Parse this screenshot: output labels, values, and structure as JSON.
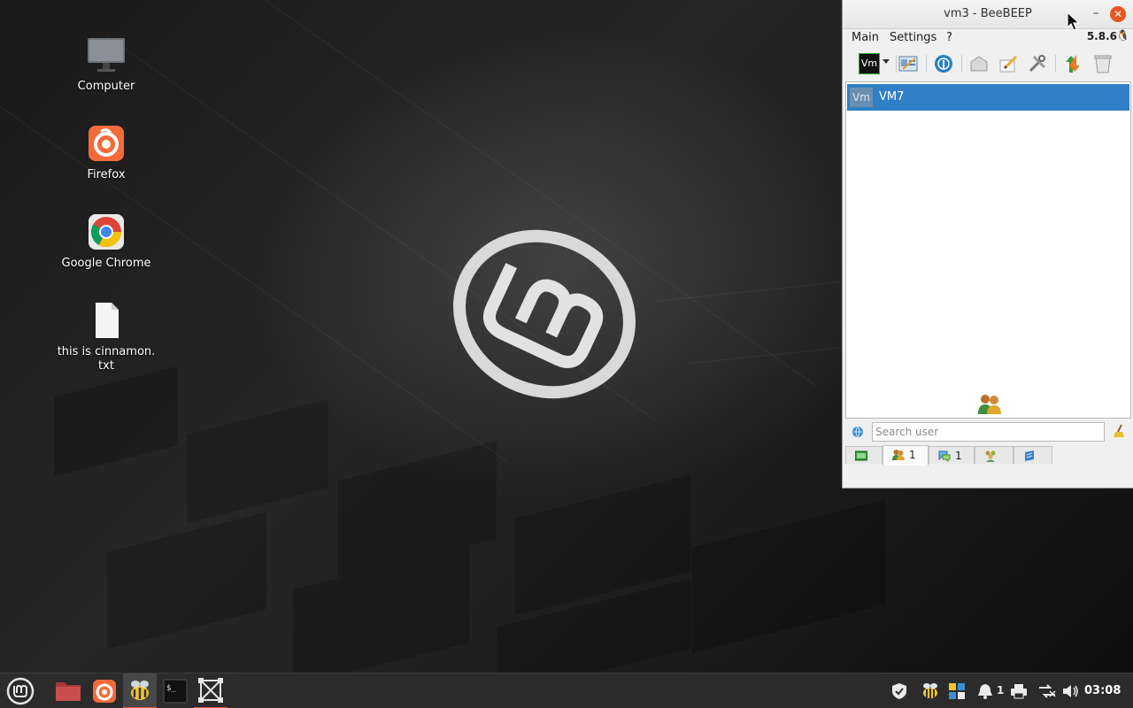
{
  "desktop": {
    "icons": [
      {
        "label": "Computer"
      },
      {
        "label": "Firefox"
      },
      {
        "label": "Google Chrome"
      },
      {
        "label_line1": "this is cinnamon.",
        "label_line2": "txt"
      }
    ]
  },
  "window": {
    "title": "vm3 - BeeBEEP",
    "minimize_symbol": "–",
    "close_symbol": "✕",
    "menu": [
      "Main",
      "Settings",
      "?"
    ],
    "version": "5.8.6",
    "avatar_text": "Vm",
    "users": [
      {
        "avatar": "Vm",
        "name": "VM7",
        "selected": true
      }
    ],
    "search": {
      "placeholder": "Search user",
      "value": ""
    },
    "tabs": [
      {
        "icon": "monitor-icon",
        "count": ""
      },
      {
        "icon": "users-icon",
        "count": "1",
        "active": true
      },
      {
        "icon": "chat-icon",
        "count": "1"
      },
      {
        "icon": "group-icon",
        "count": ""
      },
      {
        "icon": "file-share-icon",
        "count": ""
      }
    ]
  },
  "taskbar": {
    "apps": [
      "menu-icon",
      "files-icon",
      "firefox-icon",
      "beebeep-icon",
      "terminal-icon",
      "workspace-icon"
    ],
    "notifications_count": "1",
    "clock": "03:08"
  },
  "colors": {
    "accent": "#e95420",
    "selection": "#2f7fc6",
    "taskbar": "#2b2b2b"
  }
}
